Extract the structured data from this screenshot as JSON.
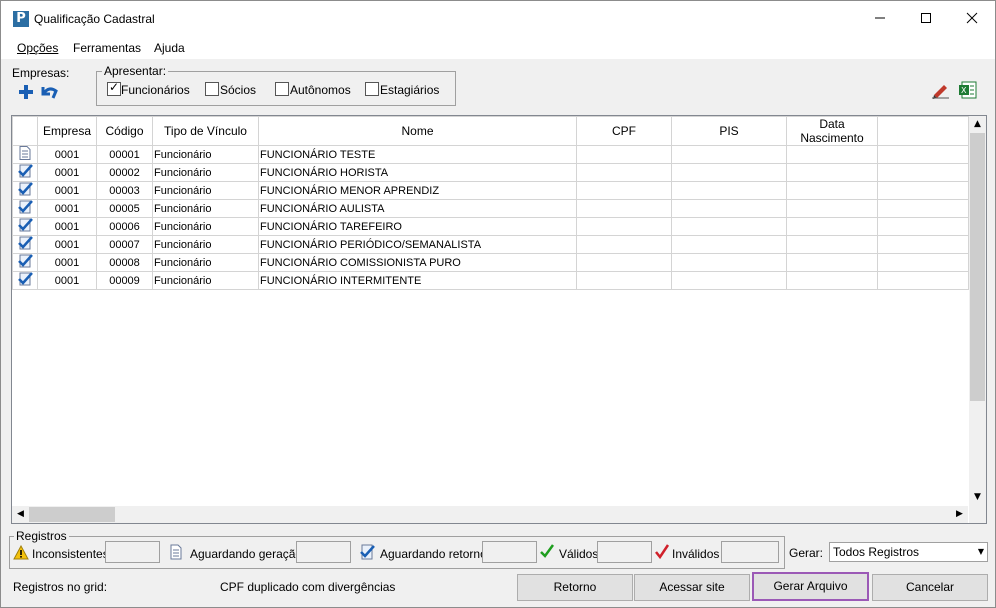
{
  "window": {
    "title": "Qualificação Cadastral",
    "app_icon_letter": "P"
  },
  "menu": [
    {
      "label": "Opções"
    },
    {
      "label": "Ferramentas"
    },
    {
      "label": "Ajuda"
    }
  ],
  "empresas": {
    "label": "Empresas:"
  },
  "apresentar": {
    "legend": "Apresentar:",
    "options": [
      {
        "label": "Funcionários",
        "checked": true
      },
      {
        "label": "Sócios",
        "checked": false
      },
      {
        "label": "Autônomos",
        "checked": false
      },
      {
        "label": "Estagiários",
        "checked": false
      }
    ]
  },
  "grid": {
    "columns": [
      "",
      "Empresa",
      "Código",
      "Tipo de Vínculo",
      "Nome",
      "CPF",
      "PIS",
      "Data Nascimento",
      ""
    ],
    "rows": [
      {
        "status": "aguardando-geracao",
        "empresa": "0001",
        "codigo": "00001",
        "tipo": "Funcionário",
        "nome": "FUNCIONÁRIO TESTE",
        "cpf": "",
        "pis": "",
        "nasc": ""
      },
      {
        "status": "aguardando-retorno",
        "empresa": "0001",
        "codigo": "00002",
        "tipo": "Funcionário",
        "nome": "FUNCIONÁRIO HORISTA",
        "cpf": "",
        "pis": "",
        "nasc": ""
      },
      {
        "status": "aguardando-retorno",
        "empresa": "0001",
        "codigo": "00003",
        "tipo": "Funcionário",
        "nome": "FUNCIONÁRIO MENOR APRENDIZ",
        "cpf": "",
        "pis": "",
        "nasc": ""
      },
      {
        "status": "aguardando-retorno",
        "empresa": "0001",
        "codigo": "00005",
        "tipo": "Funcionário",
        "nome": "FUNCIONÁRIO AULISTA",
        "cpf": "",
        "pis": "",
        "nasc": ""
      },
      {
        "status": "aguardando-retorno",
        "empresa": "0001",
        "codigo": "00006",
        "tipo": "Funcionário",
        "nome": "FUNCIONÁRIO TAREFEIRO",
        "cpf": "",
        "pis": "",
        "nasc": ""
      },
      {
        "status": "aguardando-retorno",
        "empresa": "0001",
        "codigo": "00007",
        "tipo": "Funcionário",
        "nome": "FUNCIONÁRIO PERIÓDICO/SEMANALISTA",
        "cpf": "",
        "pis": "",
        "nasc": ""
      },
      {
        "status": "aguardando-retorno",
        "empresa": "0001",
        "codigo": "00008",
        "tipo": "Funcionário",
        "nome": "FUNCIONÁRIO COMISSIONISTA PURO",
        "cpf": "",
        "pis": "",
        "nasc": ""
      },
      {
        "status": "aguardando-retorno",
        "empresa": "0001",
        "codigo": "00009",
        "tipo": "Funcionário",
        "nome": "FUNCIONÁRIO INTERMITENTE",
        "cpf": "",
        "pis": "",
        "nasc": ""
      }
    ]
  },
  "registros": {
    "legend": "Registros",
    "items": [
      {
        "label": "Inconsistentes",
        "icon": "warning-icon",
        "value": ""
      },
      {
        "label": "Aguardando geração",
        "icon": "document-icon",
        "value": ""
      },
      {
        "label": "Aguardando retorno",
        "icon": "check-doc-icon",
        "value": ""
      },
      {
        "label": "Válidos",
        "icon": "green-check-icon",
        "value": ""
      },
      {
        "label": "Inválidos",
        "icon": "red-check-icon",
        "value": ""
      }
    ]
  },
  "gerar": {
    "label": "Gerar:",
    "selected": "Todos Registros"
  },
  "footer": {
    "registros_grid_label": "Registros no grid:",
    "message": "CPF duplicado com divergências",
    "buttons": {
      "retorno": "Retorno",
      "acessar_site": "Acessar site",
      "gerar_arquivo": "Gerar Arquivo",
      "cancelar": "Cancelar"
    }
  },
  "colors": {
    "accent_border": "#9b59b6",
    "blue_icon": "#1a5fb4",
    "green_check": "#1e9e1e",
    "red_check": "#d0202a"
  }
}
